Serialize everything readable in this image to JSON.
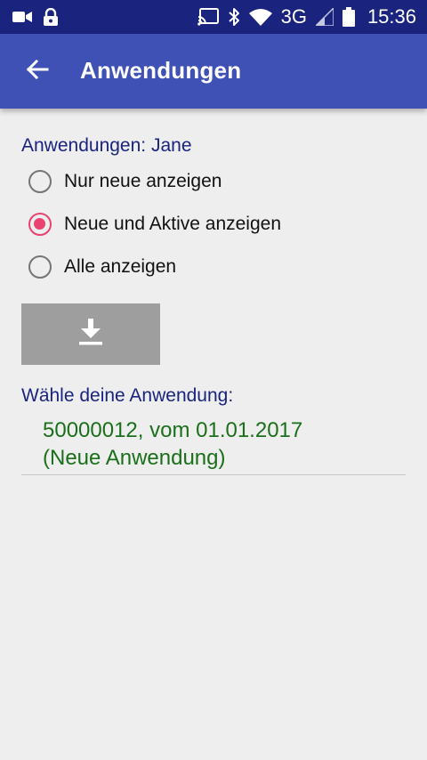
{
  "status_bar": {
    "network": "3G",
    "time": "15:36",
    "icons": [
      "video-camera-icon",
      "lock-icon",
      "cast-icon",
      "bluetooth-icon",
      "wifi-icon",
      "signal-icon",
      "battery-icon"
    ]
  },
  "app_bar": {
    "title": "Anwendungen",
    "back_icon": "arrow-back-icon",
    "color": "#3f51b5"
  },
  "filter": {
    "label": "Anwendungen: Jane",
    "options": [
      {
        "label": "Nur neue anzeigen",
        "checked": false
      },
      {
        "label": "Neue und Aktive anzeigen",
        "checked": true
      },
      {
        "label": "Alle anzeigen",
        "checked": false
      }
    ]
  },
  "download_button": {
    "icon": "download-icon"
  },
  "applications": {
    "label": "Wähle deine Anwendung:",
    "items": [
      {
        "line1": "50000012, vom 01.01.2017",
        "line2": "(Neue Anwendung)"
      }
    ]
  },
  "colors": {
    "status_bar": "#1a237e",
    "accent": "#e9436f",
    "label": "#1a237e",
    "item_text": "#1b6f1b",
    "background": "#eeeeee"
  }
}
